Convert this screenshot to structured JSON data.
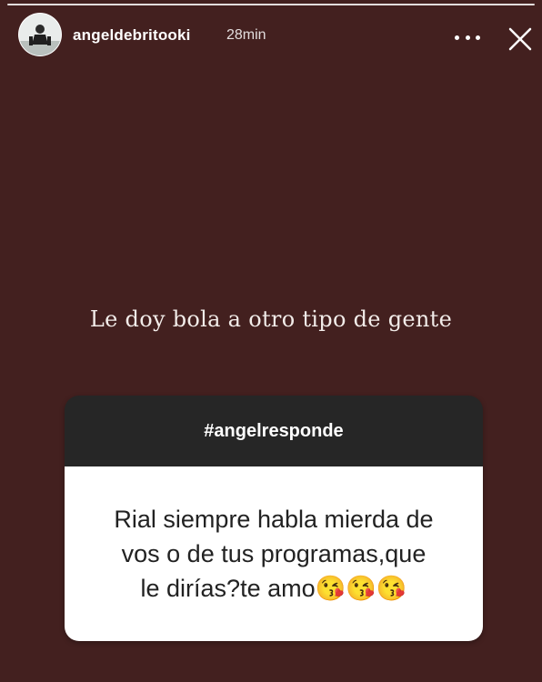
{
  "story": {
    "username": "angeldebritooki",
    "time_ago": "28min",
    "more_icon": "more-horizontal-icon",
    "close_icon": "close-icon"
  },
  "caption": "Le doy bola a otro tipo de gente",
  "question_sticker": {
    "header": "#angelresponde",
    "lines": [
      "Rial siempre habla mierda de",
      "vos o de tus programas,que",
      "le dirías?te amo😘😘😘"
    ]
  },
  "colors": {
    "background": "#43201f",
    "sticker_header": "#262626",
    "sticker_body": "#ffffff"
  }
}
